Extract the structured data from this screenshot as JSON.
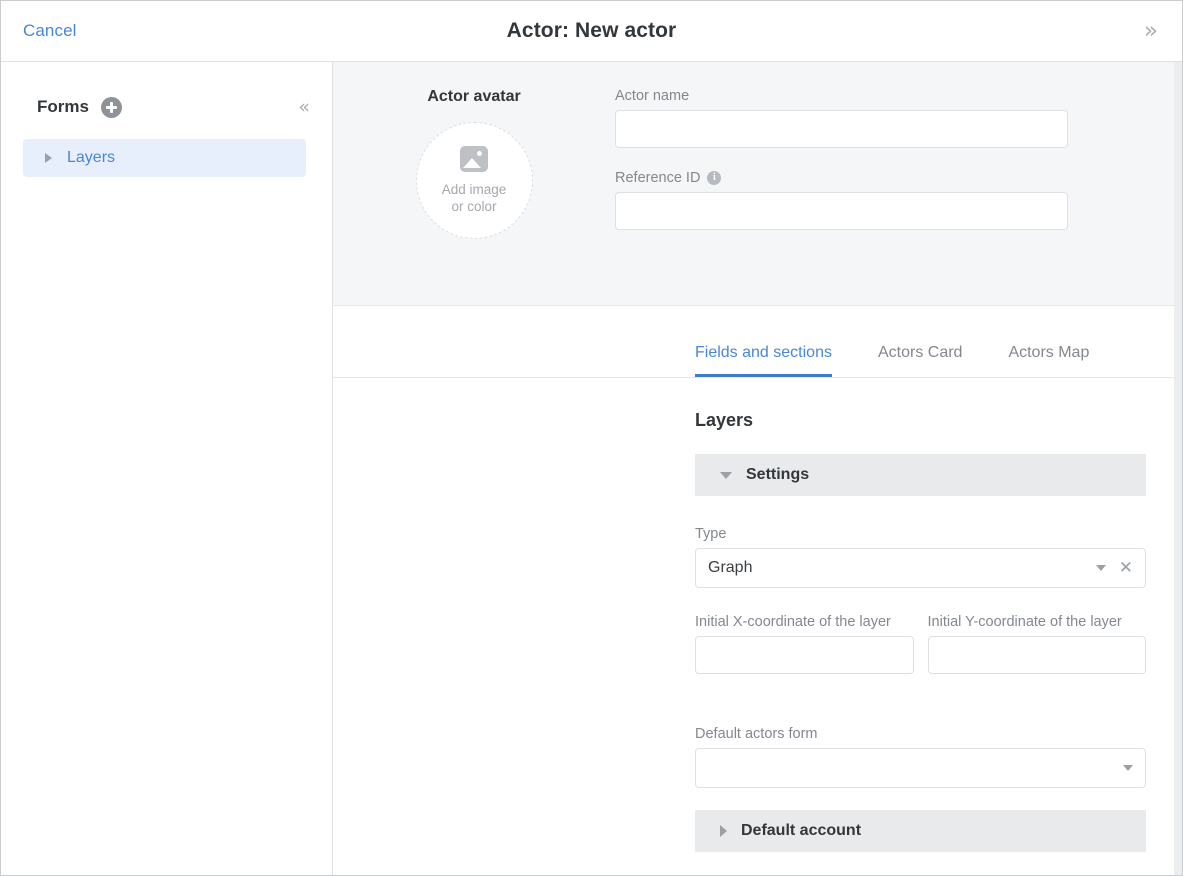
{
  "header": {
    "cancel_label": "Cancel",
    "title": "Actor: New actor",
    "expand_icon": "»"
  },
  "sidebar": {
    "title": "Forms",
    "add_icon": "plus-circle-icon",
    "collapse_icon": "«",
    "items": [
      {
        "label": "Layers",
        "selected": true,
        "expanded": false
      }
    ]
  },
  "avatar": {
    "label": "Actor avatar",
    "placeholder_line1": "Add image",
    "placeholder_line2": "or color",
    "icon": "image-icon"
  },
  "top_fields": [
    {
      "label": "Actor name",
      "value": "",
      "placeholder": "",
      "info": false
    },
    {
      "label": "Reference ID",
      "value": "",
      "placeholder": "",
      "info": true,
      "info_glyph": "i"
    }
  ],
  "tabs": [
    {
      "label": "Fields and sections",
      "active": true
    },
    {
      "label": "Actors Card",
      "active": false
    },
    {
      "label": "Actors Map",
      "active": false
    }
  ],
  "content": {
    "title": "Layers",
    "sections": [
      {
        "title": "Settings",
        "expanded": true
      },
      {
        "title": "Default account",
        "expanded": false
      }
    ],
    "type_field": {
      "label": "Type",
      "value": "Graph",
      "caret_icon": "chevron-down-icon",
      "clear_icon": "✕"
    },
    "coordinate_fields": [
      {
        "label": "Initial X-coordinate of the layer",
        "value": ""
      },
      {
        "label": "Initial Y-coordinate of the layer",
        "value": ""
      }
    ],
    "default_form_field": {
      "label": "Default actors form",
      "value": "",
      "caret_icon": "chevron-down-icon"
    }
  },
  "colors": {
    "accent": "#4a86d8",
    "selected_row_bg": "#e7effc",
    "panel_bg": "#f5f6f8",
    "section_bg": "#e9eaec",
    "muted_text": "#83888f"
  }
}
